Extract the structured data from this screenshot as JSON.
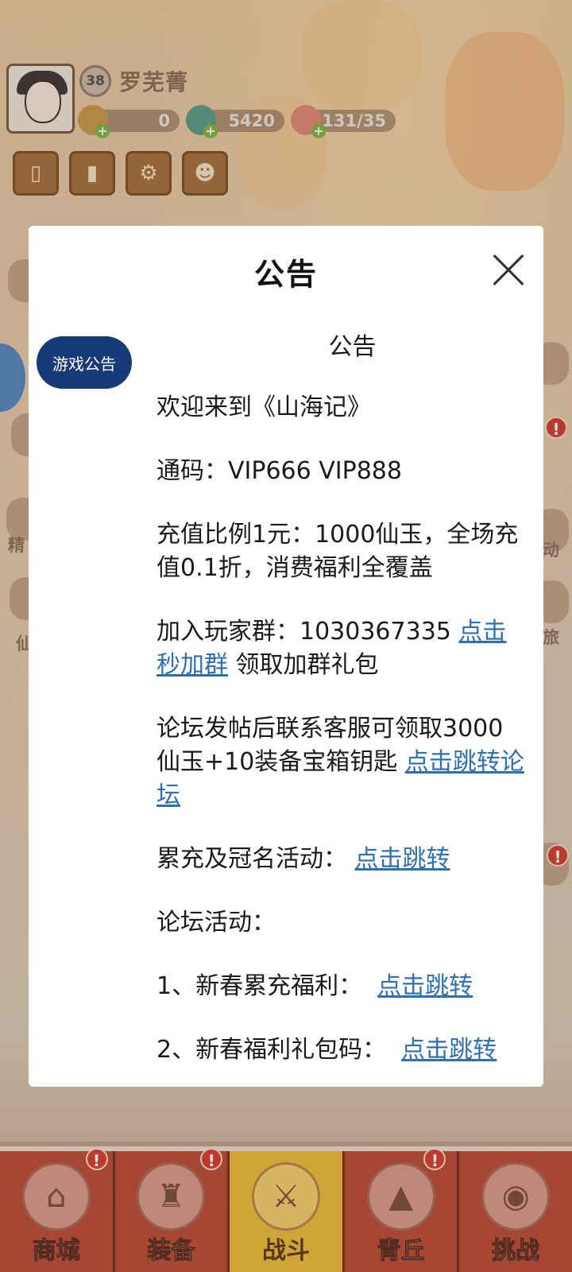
{
  "player": {
    "level": "38",
    "name": "罗芜菁",
    "resources": [
      "0",
      "5420",
      "131/35"
    ]
  },
  "side_labels": [
    "精",
    "动",
    "旅",
    "仙"
  ],
  "alert_mark": "!",
  "modal": {
    "title": "公告",
    "tab": "游戏公告",
    "heading": "公告",
    "welcome": "欢迎来到《山海记》",
    "codes": "通码：VIP666 VIP888",
    "ratio": "充值比例1元：1000仙玉，全场充值0.1折，消费福利全覆盖",
    "group_text": "加入玩家群：1030367335 ",
    "group_link": "点击秒加群",
    "group_suffix": " 领取加群礼包",
    "forum_text": "论坛发帖后联系客服可领取3000仙玉+10装备宝箱钥匙 ",
    "forum_link": "点击跳转论坛",
    "event_text": "累充及冠名活动：",
    "event_link": "点击跳转",
    "forum_activity": "论坛活动：",
    "item1_text": "1、新春累充福利：",
    "item1_link": "点击跳转",
    "item2_text": "2、新春福利礼包码：",
    "item2_link": "点击跳转"
  },
  "bottom_nav": [
    {
      "label": "商城",
      "active": false
    },
    {
      "label": "装备",
      "active": false
    },
    {
      "label": "战斗",
      "active": true
    },
    {
      "label": "青丘",
      "active": false
    },
    {
      "label": "挑战",
      "active": false
    }
  ]
}
